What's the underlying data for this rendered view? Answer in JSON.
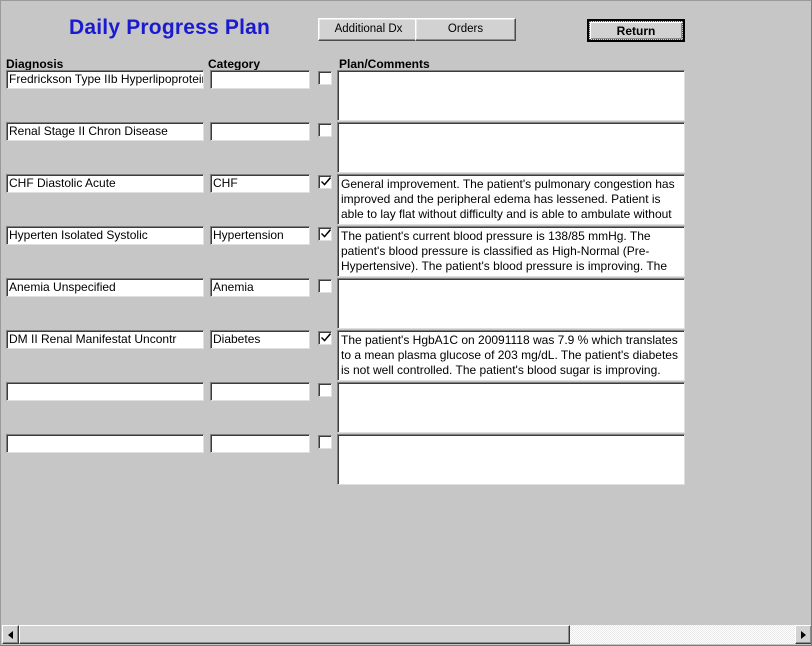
{
  "window": {
    "title": "Daily Progress Plan",
    "title_color": "#1a1ad0",
    "face_color": "#c6c6c6"
  },
  "toolbar": {
    "additional_dx_label": "Additional Dx",
    "orders_label": "Orders",
    "return_label": "Return"
  },
  "headers": {
    "diagnosis": "Diagnosis",
    "category": "Category",
    "plan": "Plan/Comments"
  },
  "rows": [
    {
      "diagnosis": "Fredrickson Type IIb Hyperlipoproteinem",
      "category": "",
      "checked": false,
      "plan": ""
    },
    {
      "diagnosis": "Renal  Stage II Chron Disease",
      "category": "",
      "checked": false,
      "plan": ""
    },
    {
      "diagnosis": "CHF Diastolic Acute",
      "category": "CHF",
      "checked": true,
      "plan": " General improvement.  The patient's pulmonary congestion has improved and the peripheral edema has lessened. Patient is able to lay flat without difficulty and is able to ambulate without SOB."
    },
    {
      "diagnosis": "Hyperten Isolated Systolic",
      "category": "Hypertension",
      "checked": true,
      "plan": " The patient's current blood pressure is 138/85 mmHg. The patient's blood pressure is classified as High-Normal (Pre-Hypertensive). The patient's blood pressure is improving. The patient has the following"
    },
    {
      "diagnosis": "Anemia  Unspecified",
      "category": "Anemia",
      "checked": false,
      "plan": ""
    },
    {
      "diagnosis": "DM  II Renal Manifestat Uncontr",
      "category": "Diabetes",
      "checked": true,
      "plan": " The patient's HgbA1C on 20091118 was 7.9 % which translates to a mean plasma glucose of 203 mg/dL. The patient's diabetes is not well controlled. The patient's blood sugar is improving. Ketosis is absent."
    },
    {
      "diagnosis": "",
      "category": "",
      "checked": false,
      "plan": ""
    },
    {
      "diagnosis": "",
      "category": "",
      "checked": false,
      "plan": ""
    }
  ],
  "scrollbar": {
    "left_arrow_icon": "triangle-left-icon",
    "right_arrow_icon": "triangle-right-icon",
    "thumb_fraction_percent": 71
  }
}
